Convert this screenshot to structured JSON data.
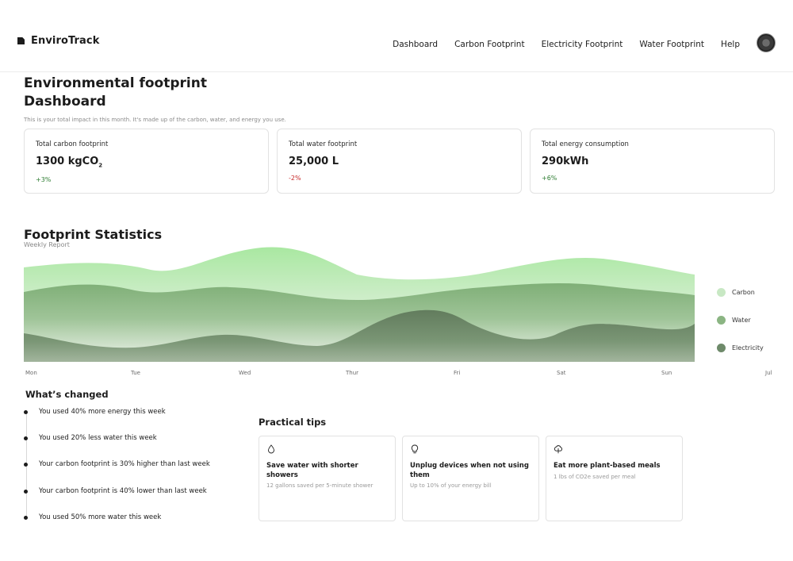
{
  "brand": {
    "name": "EnviroTrack"
  },
  "nav": {
    "items": [
      "Dashboard",
      "Carbon Footprint",
      "Electricity Footprint",
      "Water Footprint",
      "Help"
    ]
  },
  "page": {
    "title": "Environmental footprint Dashboard",
    "subtitle": "This is your total impact in this month. It's made up of the carbon, water, and energy you use."
  },
  "cards": [
    {
      "label": "Total carbon footprint",
      "value": "1300 kgCO",
      "value_sub": "2",
      "delta": "+3%",
      "delta_color": "#2e7d32"
    },
    {
      "label": "Total water footprint",
      "value": "25,000 L",
      "value_sub": "",
      "delta": "-2%",
      "delta_color": "#c62828"
    },
    {
      "label": "Total energy consumption",
      "value": "290kWh",
      "value_sub": "",
      "delta": "+6%",
      "delta_color": "#2e7d32"
    }
  ],
  "stats": {
    "title": "Footprint Statistics",
    "subtitle": "Weekly Report",
    "x_labels": [
      "Mon",
      "Tue",
      "Wed",
      "Thur",
      "Fri",
      "Sat",
      "Sun",
      "Jul"
    ],
    "legend": [
      {
        "label": "Carbon",
        "color": "#c8e8c4"
      },
      {
        "label": "Water",
        "color": "#8bb583"
      },
      {
        "label": "Electricity",
        "color": "#6e8a6a"
      }
    ]
  },
  "changes": {
    "title": "What’s changed",
    "items": [
      "You used 40% more energy this week",
      "You used 20% less water this week",
      "Your carbon footprint is 30% higher than last week",
      "Your carbon footprint is 40% lower than last week",
      "You used 50% more water this week"
    ]
  },
  "tips": {
    "title": "Practical tips",
    "items": [
      {
        "icon": "water-drop-icon",
        "title": "Save water with shorter showers",
        "desc": "12 gallons saved per 5-minute shower"
      },
      {
        "icon": "lightbulb-icon",
        "title": "Unplug devices when not using them",
        "desc": "Up to 10% of your energy bill"
      },
      {
        "icon": "tree-icon",
        "title": "Eat more plant-based meals",
        "desc": "1 lbs of CO2e saved per meal"
      }
    ]
  }
}
